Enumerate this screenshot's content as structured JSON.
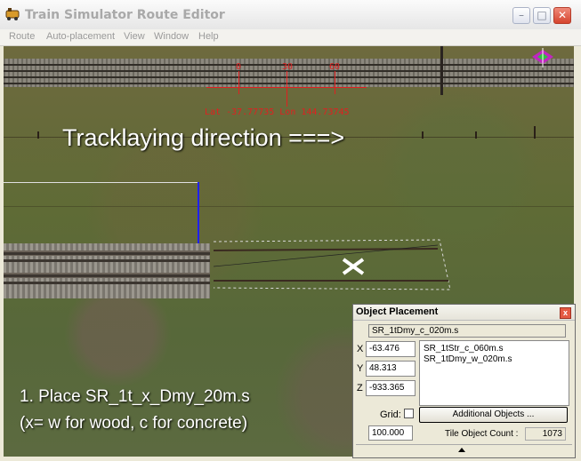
{
  "window": {
    "title": "Train Simulator Route Editor",
    "controls": {
      "minimize": "–",
      "maximize": "□",
      "close": "✕"
    }
  },
  "menu": [
    "Route",
    "Auto-placement",
    "View",
    "Window",
    "Help"
  ],
  "viewport": {
    "ruler_labels": [
      "0",
      "30",
      "60"
    ],
    "latlon": "Lat -37.77735 Lon 144.73745",
    "heading": "Tracklaying direction ===>",
    "instruction_line1": "1. Place SR_1t_x_Dmy_20m.s",
    "instruction_line2": "(x= w for wood, c for concrete)"
  },
  "object_placement": {
    "title": "Object Placement",
    "close": "x",
    "selected_file": "SR_1tDmy_c_020m.s",
    "x_label": "X",
    "x_value": "-63.476",
    "y_label": "Y",
    "y_value": "48.313",
    "z_label": "Z",
    "z_value": "-933.365",
    "objects": [
      "SR_1tStr_c_060m.s",
      "SR_1tDmy_w_020m.s"
    ],
    "grid_label": "Grid:",
    "grid_checked": false,
    "additional_objects_label": "Additional Objects ...",
    "grid_value": "100.000",
    "tile_object_count_label": "Tile Object Count :",
    "tile_object_count": "1073"
  },
  "colors": {
    "ruler": "#e02020",
    "selection_blue": "#2020ff",
    "overlay_text": "#ffffff"
  }
}
